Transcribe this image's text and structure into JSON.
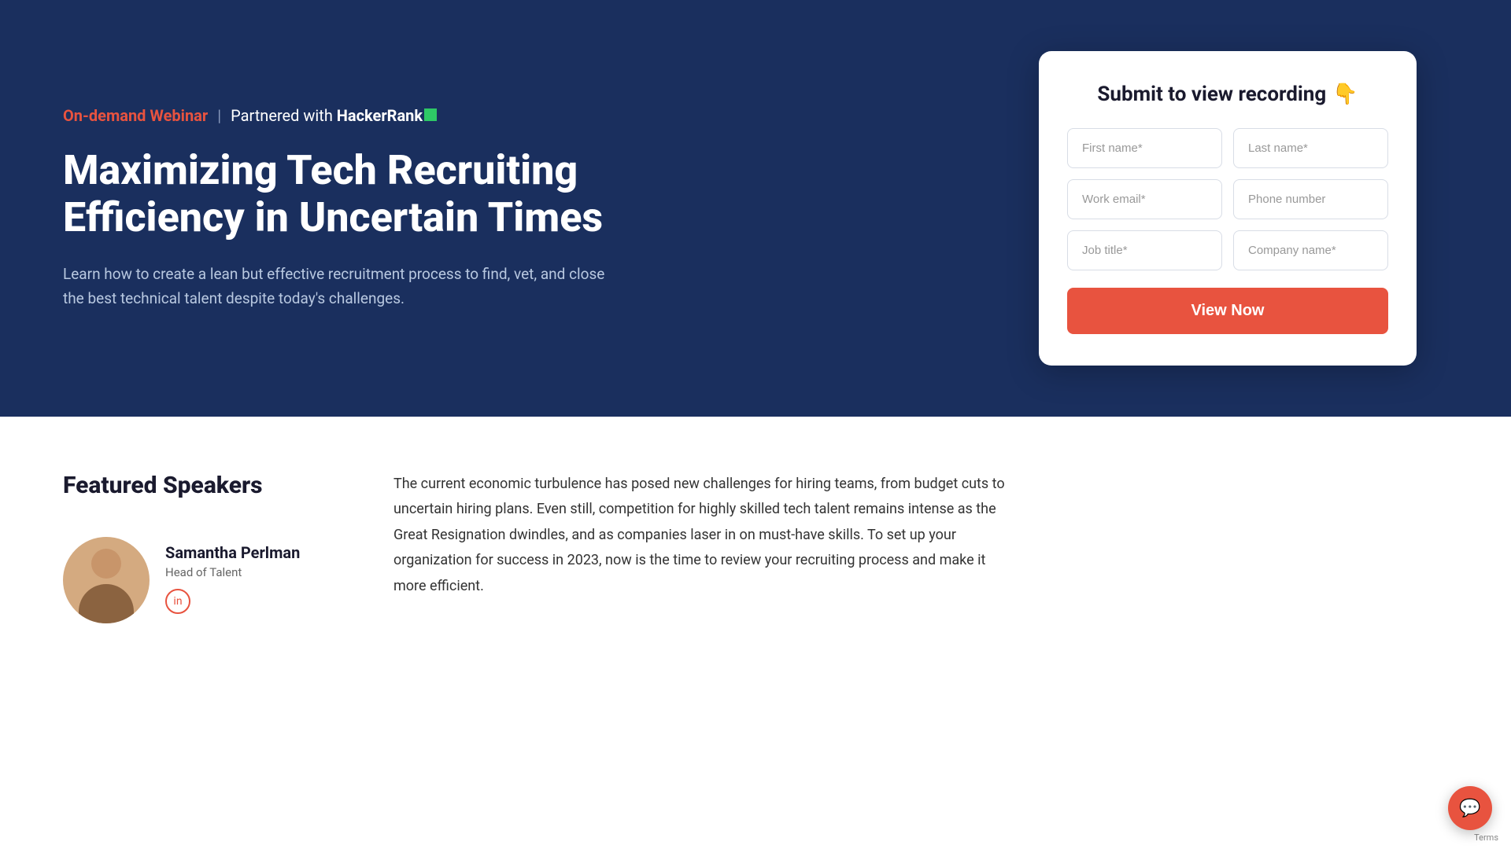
{
  "hero": {
    "badge": {
      "highlight": "On-demand Webinar",
      "divider": "|",
      "partner_text": "Partnered with ",
      "partner_name": "HackerRank"
    },
    "title": "Maximizing Tech Recruiting Efficiency in Uncertain Times",
    "description": "Learn how to create a lean but effective recruitment process to find, vet, and close the best technical talent despite today's challenges."
  },
  "form": {
    "title": "Submit to view recording",
    "title_emoji": "👇",
    "fields": {
      "first_name_placeholder": "First name*",
      "last_name_placeholder": "Last name*",
      "work_email_placeholder": "Work email*",
      "phone_placeholder": "Phone number",
      "job_title_placeholder": "Job title*",
      "company_name_placeholder": "Company name*"
    },
    "submit_label": "View Now"
  },
  "below_fold": {
    "speakers_title": "Featured Speakers",
    "speaker": {
      "name": "Samantha Perlman",
      "title": "Head of Talent",
      "social_icon": "in"
    },
    "description": "The current economic turbulence has posed new challenges for hiring teams, from budget cuts to uncertain hiring plans. Even still, competition for highly skilled tech talent remains intense as the Great Resignation dwindles, and as companies laser in on must-have skills. To set up your organization for success in 2023, now is the time to review your recruiting process and make it more efficient."
  },
  "chat": {
    "icon": "💬"
  },
  "terms": {
    "label": "Terms"
  }
}
